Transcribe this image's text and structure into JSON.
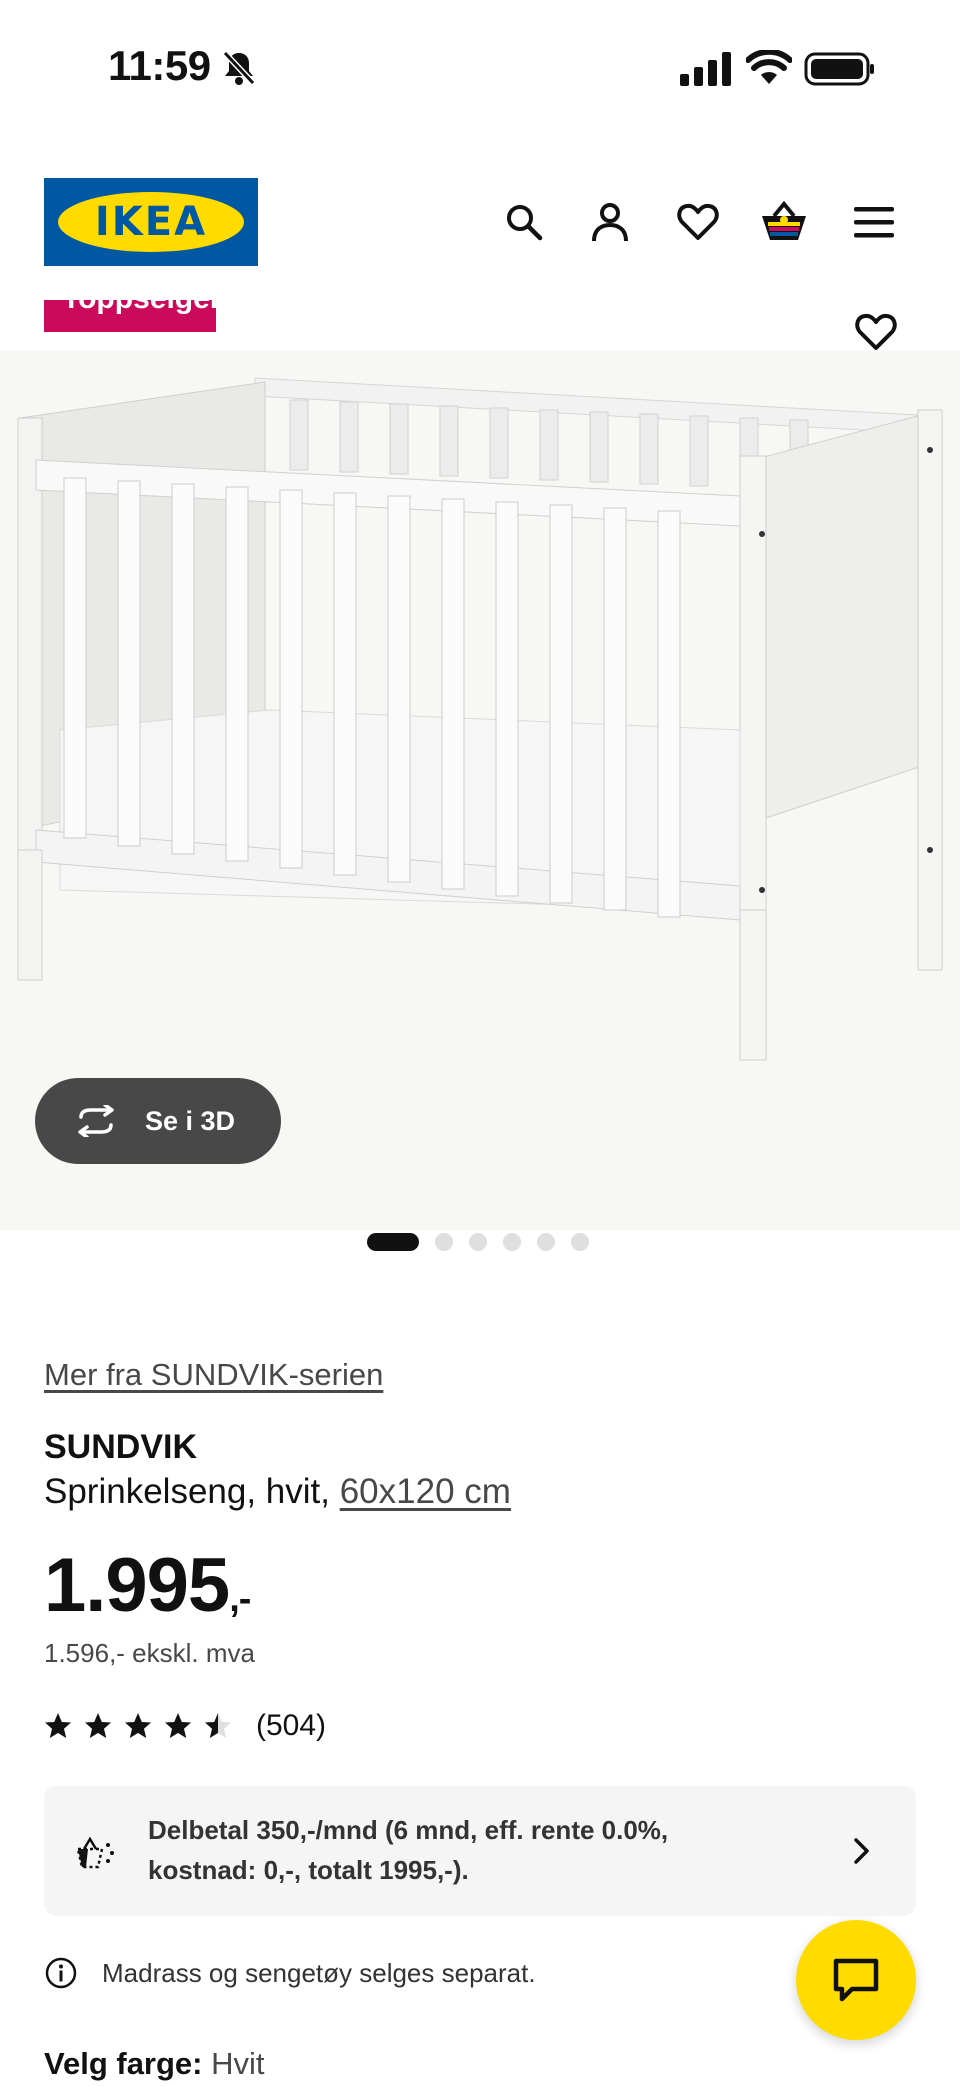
{
  "status_bar": {
    "time": "11:59"
  },
  "header": {
    "logo_text": "IKEA",
    "icons": [
      "search-icon",
      "profile-icon",
      "heart-icon",
      "basket-icon",
      "menu-icon"
    ]
  },
  "product_media": {
    "badge": "Toppselger",
    "view_3d_label": "Se i 3D",
    "carousel": {
      "total": 6,
      "active": 1
    }
  },
  "product": {
    "series_link": "Mer fra SUNDVIK-serien",
    "name": "SUNDVIK",
    "description": "Sprinkelseng, hvit,",
    "size": "60x120 cm",
    "price_main": "1.995",
    "price_suffix": ",-",
    "price_ex_vat": "1.596,- ekskl. mva",
    "rating": {
      "stars": 4.5,
      "count": "(504)"
    }
  },
  "payment": {
    "text": "Delbetal 350,-/mnd (6 mnd, eff. rente 0.0%, kostnad: 0,-, totalt 1995,-)."
  },
  "info": {
    "text": "Madrass og sengetøy selges separat."
  },
  "color_select": {
    "label": "Velg farge:",
    "value": "Hvit"
  },
  "colors": {
    "ikea_blue": "#0058a3",
    "ikea_yellow": "#ffdb00",
    "badge_pink": "#cc0a5c",
    "button_dark": "#484848"
  }
}
